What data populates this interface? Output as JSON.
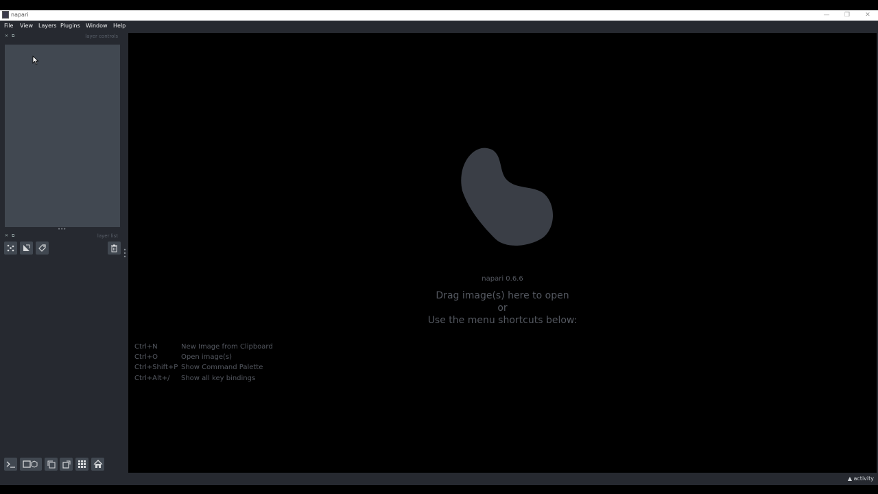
{
  "window": {
    "title": "napari",
    "minimize": "—",
    "restore": "❐",
    "close": "✕"
  },
  "menu": [
    "File",
    "View",
    "Layers",
    "Plugins",
    "Window",
    "Help"
  ],
  "docks": {
    "layer_controls_label": "layer controls",
    "layer_list_label": "layer list"
  },
  "layer_buttons": {
    "new_points": "points-icon",
    "new_shapes": "shapes-icon",
    "new_labels": "labels-icon",
    "delete": "trash-icon"
  },
  "viewer_buttons": {
    "console": "console-icon",
    "ndisplay": "ndisplay-icon",
    "roll": "roll-dims-icon",
    "transpose": "transpose-icon",
    "grid": "grid-icon",
    "home": "home-icon"
  },
  "welcome": {
    "version": "napari 0.6.6",
    "line1": "Drag image(s) here to open",
    "line2": "or",
    "line3": "Use the menu shortcuts below:",
    "shortcuts": [
      {
        "key": "Ctrl+N",
        "desc": "New Image from Clipboard"
      },
      {
        "key": "Ctrl+O",
        "desc": "Open image(s)"
      },
      {
        "key": "Ctrl+Shift+P",
        "desc": "Show Command Palette"
      },
      {
        "key": "Ctrl+Alt+/",
        "desc": "Show all key bindings"
      }
    ]
  },
  "status": {
    "activity": "▲ activity"
  },
  "colors": {
    "panel": "#262930",
    "foreground": "#414851",
    "canvas": "#000000",
    "logo": "#3a3e46"
  }
}
